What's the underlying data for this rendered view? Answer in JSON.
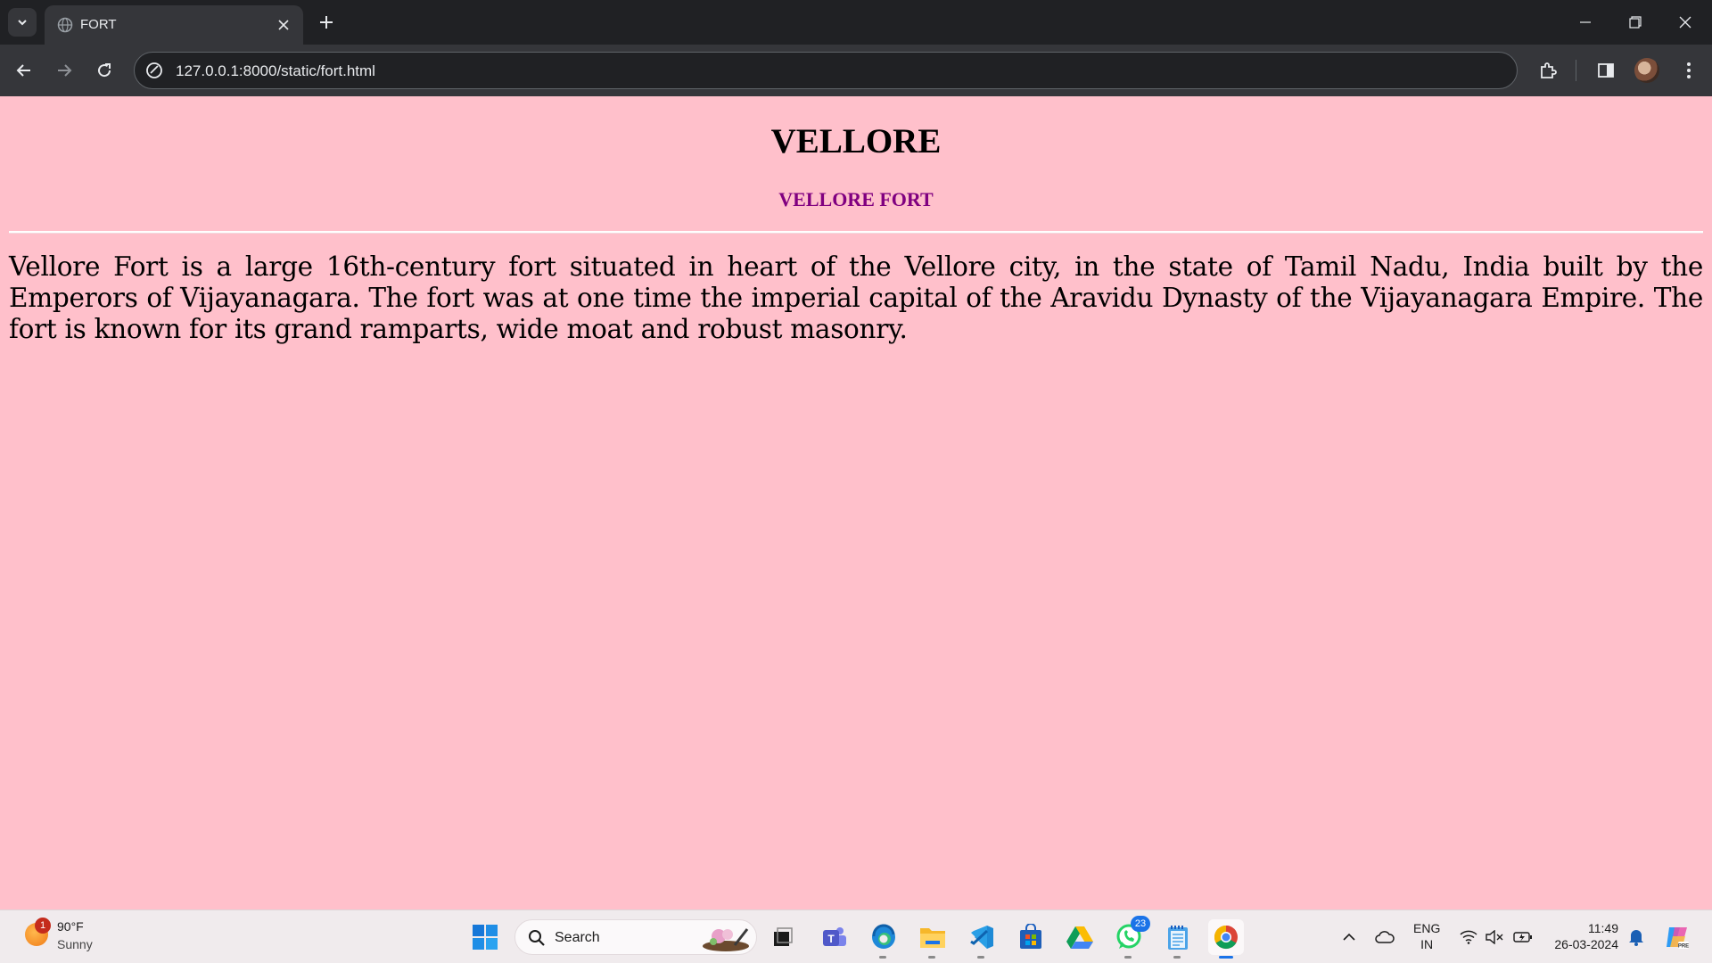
{
  "browser": {
    "tab_title": "FORT",
    "url": "127.0.0.1:8000/static/fort.html"
  },
  "page": {
    "heading": "VELLORE",
    "subheading": "VELLORE FORT",
    "paragraph": "Vellore Fort is a large 16th-century fort situated in heart of the Vellore city, in the state of Tamil Nadu, India built by the Emperors of Vijayanagara. The fort was at one time the imperial capital of the Aravidu Dynasty of the Vijayanagara Empire. The fort is known for its grand ramparts, wide moat and robust masonry.",
    "background_color": "#ffc0cb",
    "subheading_color": "#800080"
  },
  "taskbar": {
    "weather": {
      "badge": "1",
      "temp": "90°F",
      "condition": "Sunny"
    },
    "search_label": "Search",
    "whatsapp_badge": "23",
    "language": {
      "line1": "ENG",
      "line2": "IN"
    },
    "clock": {
      "time": "11:49",
      "date": "26-03-2024"
    }
  }
}
